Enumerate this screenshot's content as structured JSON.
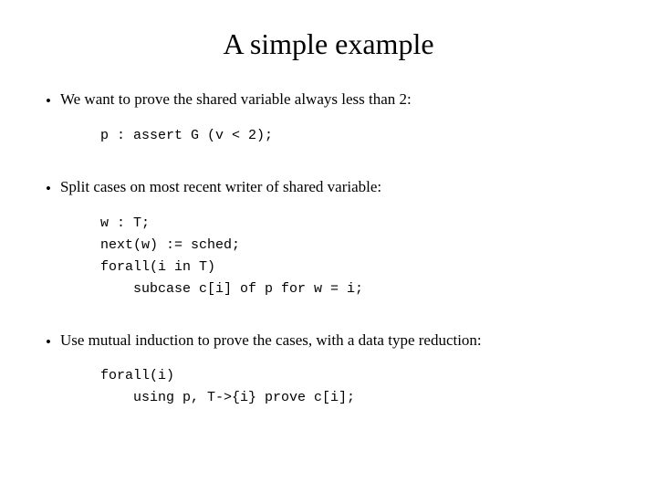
{
  "slide": {
    "title": "A simple example",
    "bullets": [
      {
        "id": "bullet1",
        "text": "We want to prove the shared variable always less than 2:",
        "code": "p : assert G (v < 2);"
      },
      {
        "id": "bullet2",
        "text": "Split cases on most recent writer of shared variable:",
        "code": "w : T;\nnext(w) := sched;\nforall(i in T)\n    subcase c[i] of p for w = i;"
      },
      {
        "id": "bullet3",
        "text": "Use mutual induction to prove the cases, with a data type reduction:",
        "code": "forall(i)\n    using p, T->{i} prove c[i];"
      }
    ]
  }
}
